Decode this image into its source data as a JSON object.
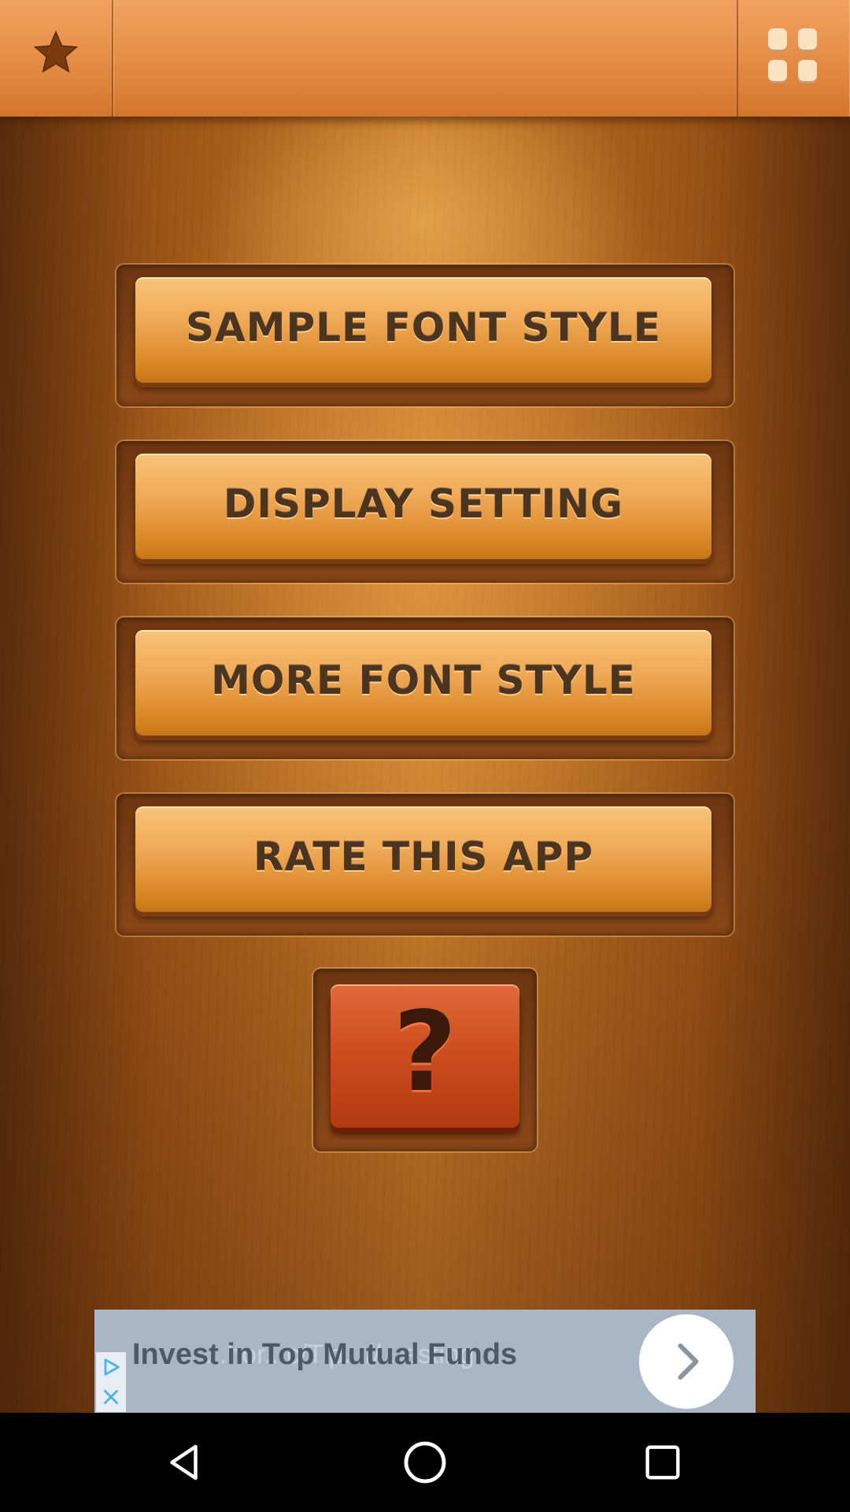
{
  "topbar": {
    "favorite_icon": "star-icon",
    "menu_icon": "grid-icon"
  },
  "menu": {
    "items": [
      {
        "label": "SAMPLE FONT STYLE"
      },
      {
        "label": "DISPLAY SETTING"
      },
      {
        "label": "MORE FONT STYLE"
      },
      {
        "label": "RATE THIS APP"
      }
    ]
  },
  "help": {
    "label": "?"
  },
  "ad": {
    "text": "Invest in Top Mutual Funds",
    "ghost_text": "...hor...c/Tip...//...esting",
    "play_icon": "play-icon",
    "close_icon": "close-icon",
    "arrow_icon": "chevron-right-icon"
  },
  "navbar": {
    "back_icon": "back-triangle-icon",
    "home_icon": "home-circle-icon",
    "recents_icon": "recents-square-icon"
  },
  "colors": {
    "wood_light": "#c77a28",
    "wood_dark": "#5a2c0c",
    "button_gold": "#efa855",
    "button_text": "#4b3420",
    "help_red": "#cd4e1f",
    "ad_bg": "#a8b6c6",
    "ad_accent": "#4fb3e6"
  }
}
